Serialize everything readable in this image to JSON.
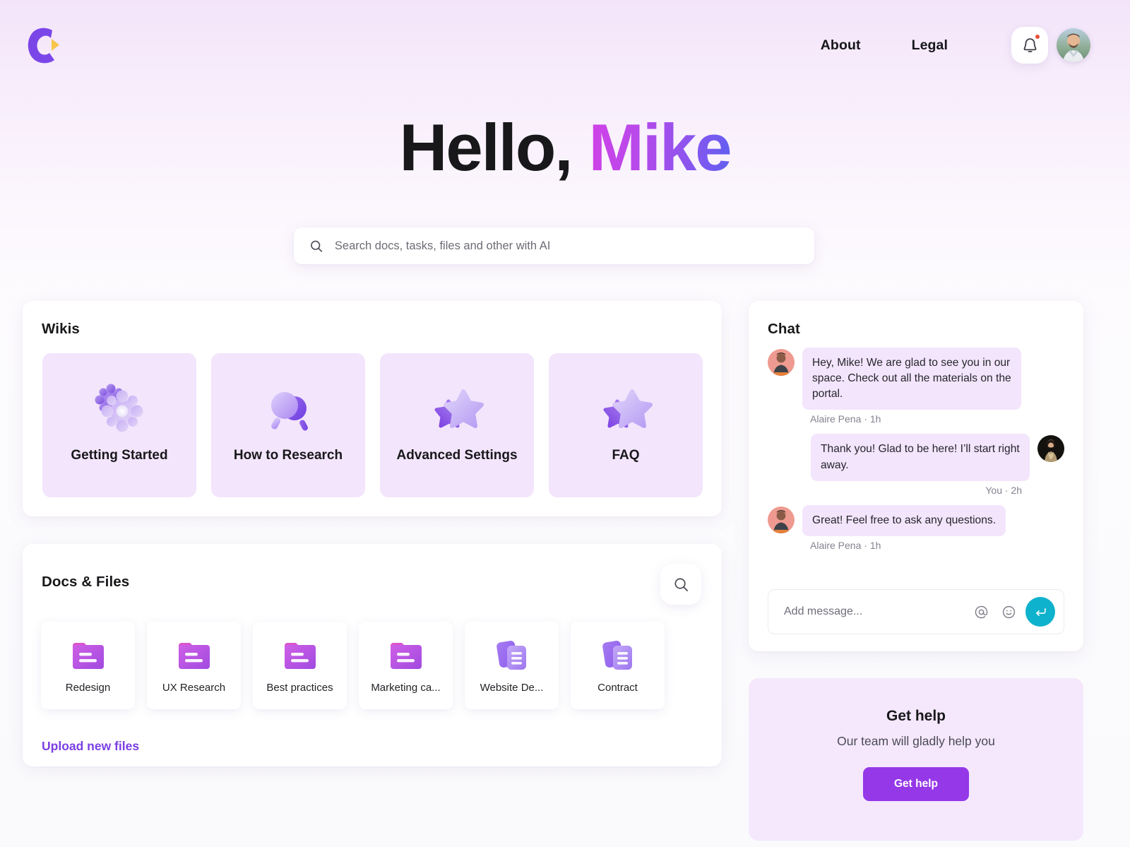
{
  "header": {
    "logo_name": "brand-logo-c",
    "nav": [
      {
        "label": "About"
      },
      {
        "label": "Legal"
      }
    ],
    "notification_icon": "bell-icon",
    "notification_has_badge": true,
    "avatar_alt": "Mike profile photo"
  },
  "hero": {
    "greeting": "Hello,",
    "user_name": "Mike",
    "gradient_from": "#d042e8",
    "gradient_to": "#5f5ff2"
  },
  "search": {
    "icon": "search-icon",
    "placeholder": "Search docs, tasks, files and other with AI",
    "value": ""
  },
  "wikis": {
    "title": "Wikis",
    "card_bg": "#f3e5fc",
    "items": [
      {
        "label": "Getting Started",
        "icon": "gears-icon"
      },
      {
        "label": "How to Research",
        "icon": "magnifiers-icon"
      },
      {
        "label": "Advanced Settings",
        "icon": "stars-icon"
      },
      {
        "label": "FAQ",
        "icon": "stars-icon"
      }
    ]
  },
  "docs": {
    "title": "Docs & Files",
    "search_icon": "search-icon",
    "upload_label": "Upload new files",
    "upload_color": "#7b3fe4",
    "items": [
      {
        "label": "Redesign",
        "icon": "folder-icon"
      },
      {
        "label": "UX Research",
        "icon": "folder-icon"
      },
      {
        "label": "Best practices",
        "icon": "folder-icon"
      },
      {
        "label": "Marketing ca...",
        "icon": "folder-icon"
      },
      {
        "label": "Website De...",
        "icon": "documents-icon"
      },
      {
        "label": "Contract",
        "icon": "documents-icon"
      }
    ]
  },
  "chat": {
    "title": "Chat",
    "messages": [
      {
        "side": "left",
        "text": "Hey, Mike! We are glad to see you in our space. Check out all the materials on the portal.",
        "meta": "Alaire Pena · 1h"
      },
      {
        "side": "right",
        "text": "Thank you! Glad to be here! I’ll start right away.",
        "meta": "You · 2h"
      },
      {
        "side": "left",
        "text": "Great! Feel free to ask any questions.",
        "meta": "Alaire Pena · 1h"
      }
    ],
    "composer": {
      "placeholder": "Add message...",
      "value": "",
      "mention_icon": "at-mention-icon",
      "emoji_icon": "smiley-icon",
      "send_icon": "enter-arrow-icon",
      "send_color": "#0fb2cc"
    }
  },
  "get_help": {
    "title": "Get help",
    "subtitle": "Our team will gladly help you",
    "button_label": "Get help",
    "button_color": "#9538e8",
    "card_bg": "#f5e8fd"
  }
}
